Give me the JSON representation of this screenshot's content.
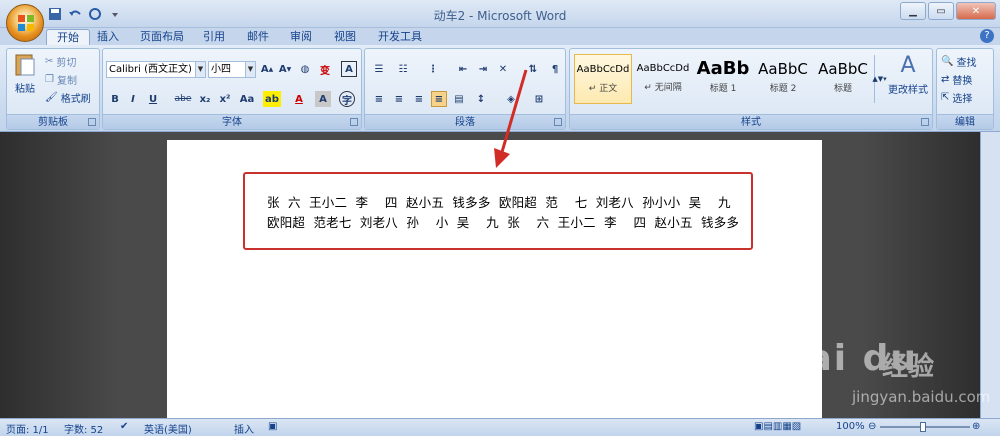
{
  "window": {
    "title": "动车2 - Microsoft Word"
  },
  "tabs": [
    "开始",
    "插入",
    "页面布局",
    "引用",
    "邮件",
    "审阅",
    "视图",
    "开发工具"
  ],
  "clipboard": {
    "paste": "粘贴",
    "cut": "剪切",
    "copy": "复制",
    "format_painter": "格式刷",
    "label": "剪贴板"
  },
  "font": {
    "name": "Calibri (西文正文)",
    "size": "小四",
    "label": "字体",
    "bold": "B",
    "italic": "I",
    "underline": "U",
    "strike": "abe",
    "sub": "x₂",
    "sup": "x²",
    "case": "Aa",
    "phonetic": "变",
    "border_char": "A",
    "circle_char": "字"
  },
  "paragraph": {
    "label": "段落"
  },
  "styles": {
    "label": "样式",
    "items": [
      {
        "sample": "AaBbCcDd",
        "name": "↵ 正文"
      },
      {
        "sample": "AaBbCcDd",
        "name": "↵ 无间隔"
      },
      {
        "sample": "AaBb",
        "name": "标题 1"
      },
      {
        "sample": "AaBbC",
        "name": "标题 2"
      },
      {
        "sample": "AaBbC",
        "name": "标题"
      }
    ],
    "change": "更改样式"
  },
  "editing": {
    "label": "编辑",
    "find": "查找",
    "replace": "替换",
    "select": "选择"
  },
  "document": {
    "line1": "张  六  王小二  李    四  赵小五  钱多多  欧阳超  范    七  刘老八  孙小小  吴    九",
    "line2": "欧阳超  范老七  刘老八  孙    小  吴    九  张    六  王小二  李    四  赵小五  钱多多"
  },
  "status": {
    "page": "页面: 1/1",
    "words": "字数: 52",
    "language": "英语(美国)",
    "mode": "插入",
    "zoom": "100%"
  },
  "watermark": {
    "brand": "Bai  du",
    "cn": "经验",
    "url": "jingyan.baidu.com"
  },
  "colors": {
    "highlight": "#c8312c",
    "accent": "#15428b"
  }
}
